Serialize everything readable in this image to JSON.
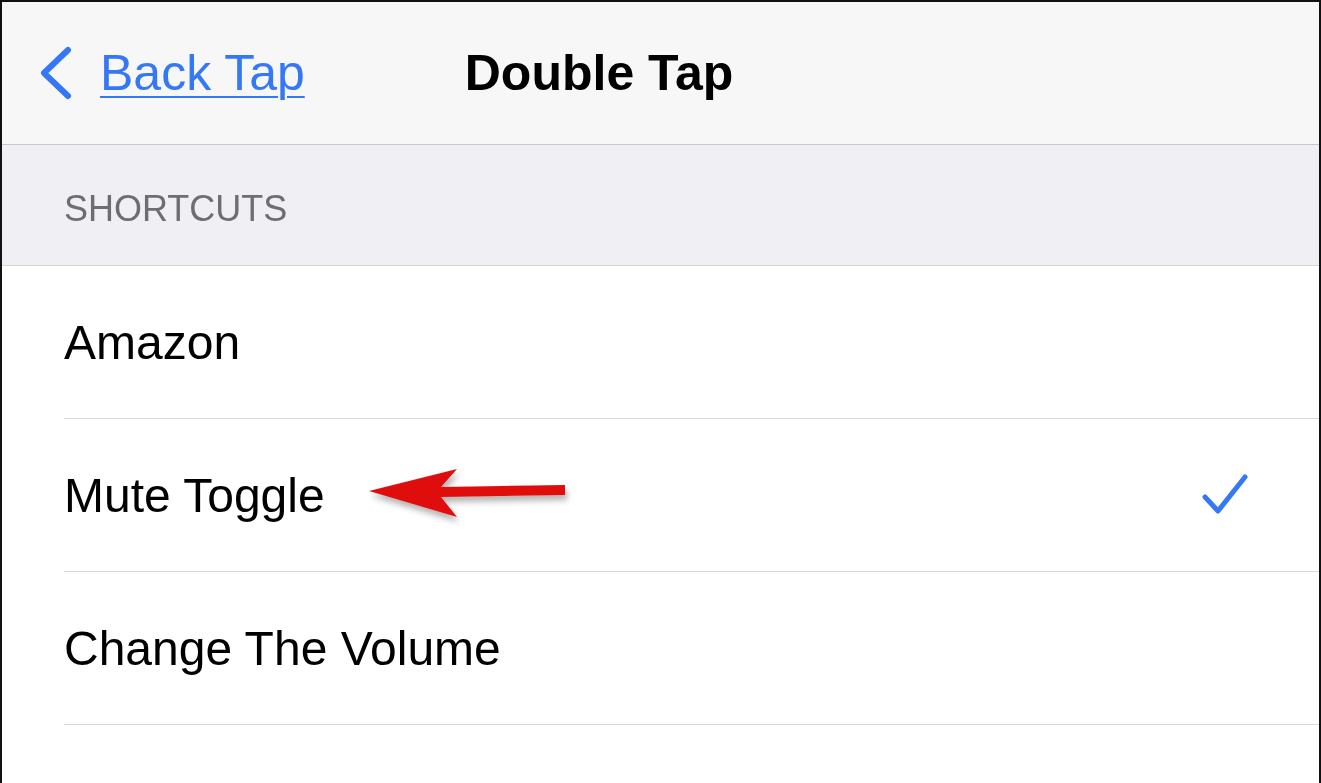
{
  "nav_bar": {
    "back_label": "Back Tap",
    "title": "Double Tap"
  },
  "section": {
    "header": "SHORTCUTS",
    "rows": [
      {
        "label": "Amazon",
        "selected": false,
        "arrow": false
      },
      {
        "label": "Mute Toggle",
        "selected": true,
        "arrow": true
      },
      {
        "label": "Change The Volume",
        "selected": false,
        "arrow": false
      }
    ]
  }
}
